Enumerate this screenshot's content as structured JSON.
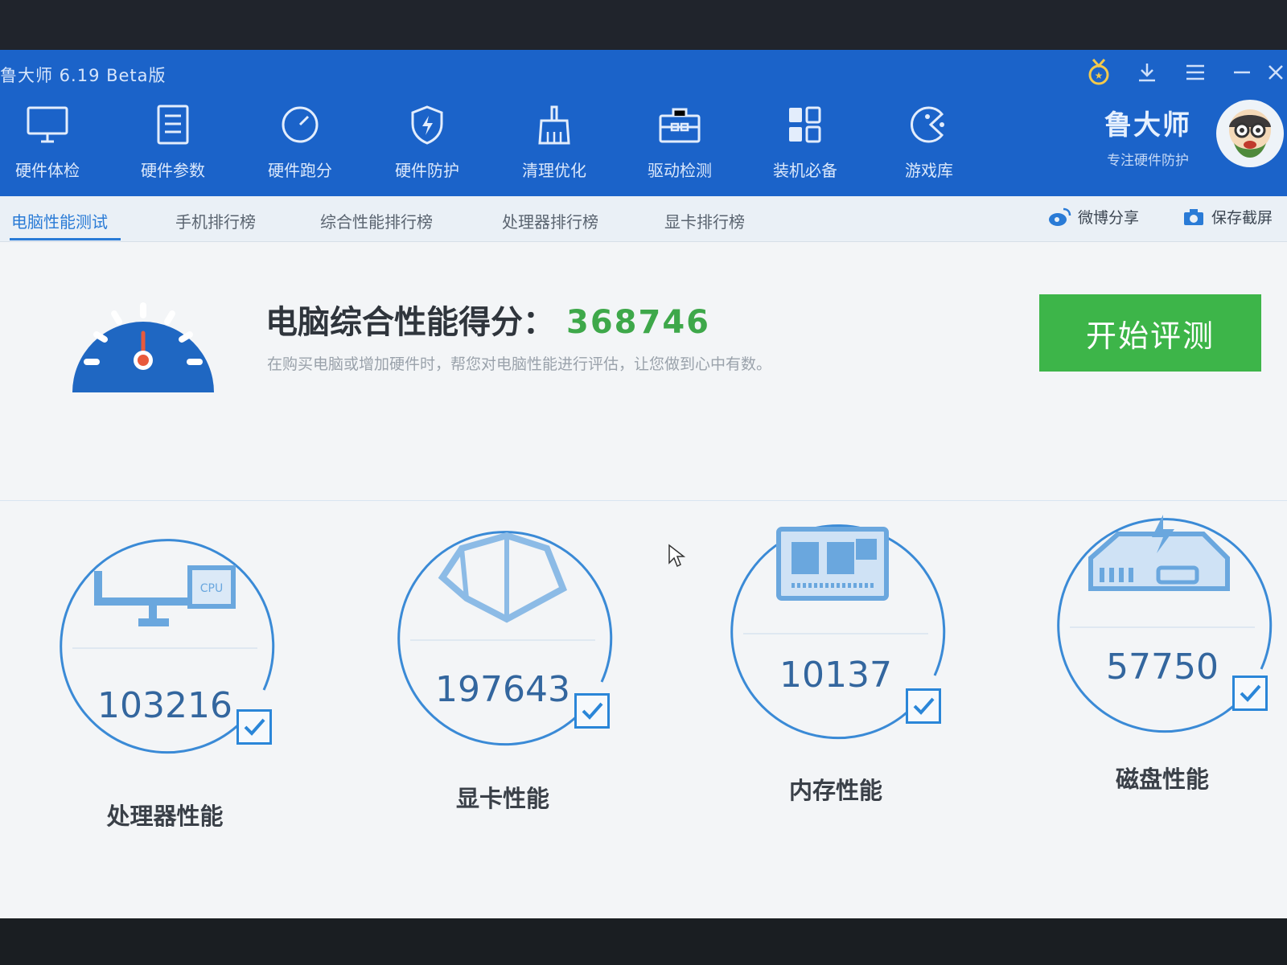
{
  "window": {
    "title": "鲁大师 6.19 Beta版"
  },
  "title_controls": [
    "medal-icon",
    "download-icon",
    "menu-icon",
    "minimize-icon",
    "close-icon"
  ],
  "toolbar": {
    "items": [
      {
        "label": "硬件体检",
        "icon": "monitor-icon"
      },
      {
        "label": "硬件参数",
        "icon": "list-icon"
      },
      {
        "label": "硬件跑分",
        "icon": "speedometer-icon"
      },
      {
        "label": "硬件防护",
        "icon": "shield-icon"
      },
      {
        "label": "清理优化",
        "icon": "broom-icon"
      },
      {
        "label": "驱动检测",
        "icon": "toolbox-icon"
      },
      {
        "label": "装机必备",
        "icon": "apps-icon"
      },
      {
        "label": "游戏库",
        "icon": "game-icon"
      }
    ]
  },
  "brand": {
    "name": "鲁大师",
    "slogan": "专注硬件防护"
  },
  "tabs": {
    "items": [
      "电脑性能测试",
      "手机排行榜",
      "综合性能排行榜",
      "处理器排行榜",
      "显卡排行榜"
    ],
    "active_index": 0
  },
  "actions": {
    "weibo": "微博分享",
    "screenshot": "保存截屏"
  },
  "score": {
    "label": "电脑综合性能得分：",
    "value": "368746",
    "subtitle": "在购买电脑或增加硬件时，帮您对电脑性能进行评估，让您做到心中有数。"
  },
  "start_button": {
    "label": "开始评测"
  },
  "metrics": [
    {
      "value": "103216",
      "label": "处理器性能",
      "checked": true,
      "icon": "cpu-monitor-icon"
    },
    {
      "value": "197643",
      "label": "显卡性能",
      "checked": true,
      "icon": "gpu-cube-icon"
    },
    {
      "value": "10137",
      "label": "内存性能",
      "checked": true,
      "icon": "memory-chip-icon"
    },
    {
      "value": "57750",
      "label": "磁盘性能",
      "checked": true,
      "icon": "disk-drive-icon"
    }
  ],
  "colors": {
    "primary": "#1b63c9",
    "accent": "#2a7bd6",
    "score_green": "#3ea84a",
    "button_green": "#3db549",
    "ring_blue": "#3a8ad6"
  }
}
